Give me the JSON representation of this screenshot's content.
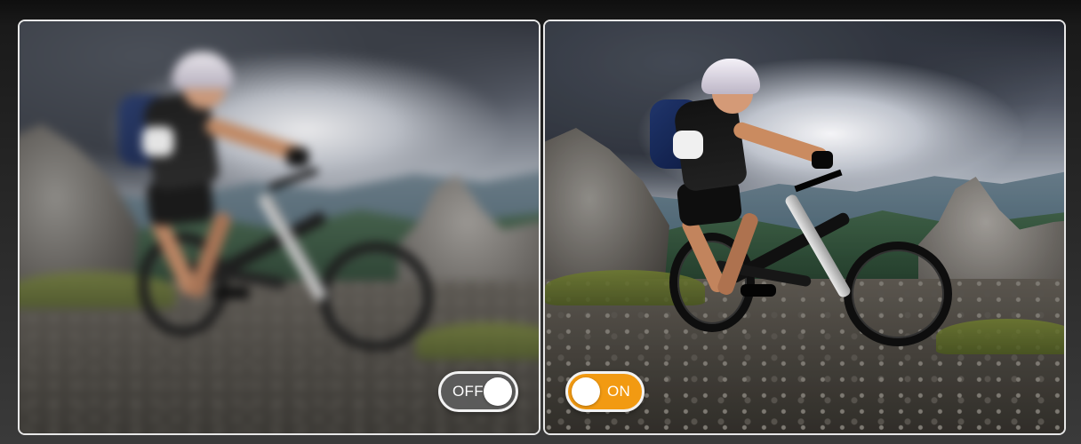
{
  "comparison": {
    "before": {
      "toggle_label": "OFF",
      "toggle_state": "off",
      "toggle_color": "#5f5f5f",
      "image_label": "blurred-mountain-biker-photo"
    },
    "after": {
      "toggle_label": "ON",
      "toggle_state": "on",
      "toggle_color": "#f29a12",
      "image_label": "sharp-mountain-biker-photo"
    }
  },
  "accent_color": "#f29a12"
}
